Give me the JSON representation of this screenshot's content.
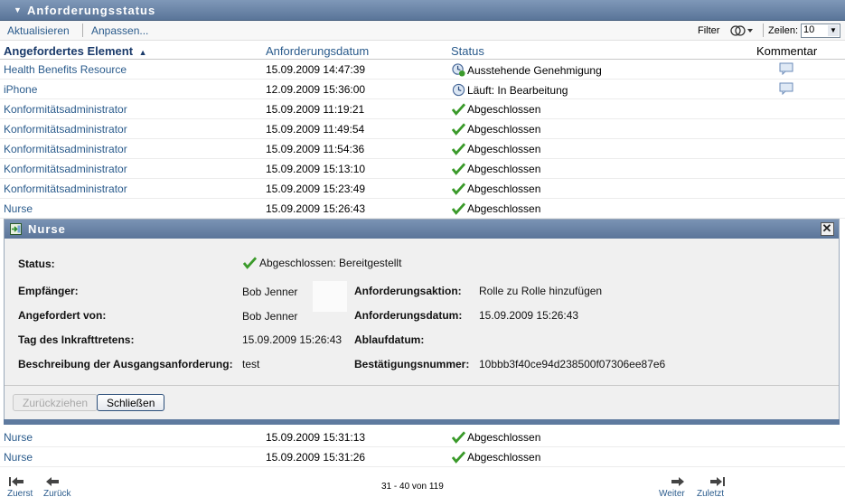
{
  "panel": {
    "title": "Anforderungsstatus"
  },
  "toolbar": {
    "refresh": "Aktualisieren",
    "customize": "Anpassen...",
    "filter_label": "Filter",
    "rows_label": "Zeilen:",
    "rows_value": "10"
  },
  "table": {
    "headers": {
      "element": "Angefordertes Element",
      "date": "Anforderungsdatum",
      "status": "Status",
      "comment": "Kommentar"
    },
    "rows": [
      {
        "element": "Health Benefits Resource",
        "date": "15.09.2009 14:47:39",
        "status": "Ausstehende Genehmigung",
        "status_icon": "pending-approval-icon",
        "has_comment": true
      },
      {
        "element": "iPhone",
        "date": "12.09.2009 15:36:00",
        "status": "Läuft: In Bearbeitung",
        "status_icon": "clock-icon",
        "has_comment": true
      },
      {
        "element": "Konformitätsadministrator",
        "date": "15.09.2009 11:19:21",
        "status": "Abgeschlossen",
        "status_icon": "check-icon",
        "has_comment": false
      },
      {
        "element": "Konformitätsadministrator",
        "date": "15.09.2009 11:49:54",
        "status": "Abgeschlossen",
        "status_icon": "check-icon",
        "has_comment": false
      },
      {
        "element": "Konformitätsadministrator",
        "date": "15.09.2009 11:54:36",
        "status": "Abgeschlossen",
        "status_icon": "check-icon",
        "has_comment": false
      },
      {
        "element": "Konformitätsadministrator",
        "date": "15.09.2009 15:13:10",
        "status": "Abgeschlossen",
        "status_icon": "check-icon",
        "has_comment": false
      },
      {
        "element": "Konformitätsadministrator",
        "date": "15.09.2009 15:23:49",
        "status": "Abgeschlossen",
        "status_icon": "check-icon",
        "has_comment": false
      },
      {
        "element": "Nurse",
        "date": "15.09.2009 15:26:43",
        "status": "Abgeschlossen",
        "status_icon": "check-icon",
        "has_comment": false
      },
      {
        "element": "Nurse",
        "date": "15.09.2009 15:31:13",
        "status": "Abgeschlossen",
        "status_icon": "check-icon",
        "has_comment": false
      },
      {
        "element": "Nurse",
        "date": "15.09.2009 15:31:26",
        "status": "Abgeschlossen",
        "status_icon": "check-icon",
        "has_comment": false
      }
    ]
  },
  "detail": {
    "title": "Nurse",
    "status_label": "Status:",
    "status_value": "Abgeschlossen: Bereitgestellt",
    "recipient_label": "Empfänger:",
    "recipient_value": "Bob Jenner",
    "requested_by_label": "Angefordert von:",
    "requested_by_value": "Bob Jenner",
    "effective_label": "Tag des Inkrafttretens:",
    "effective_value": "15.09.2009 15:26:43",
    "description_label": "Beschreibung der Ausgangsanforderung:",
    "description_value": "test",
    "action_label": "Anforderungsaktion:",
    "action_value": "Rolle zu Rolle hinzufügen",
    "req_date_label": "Anforderungsdatum:",
    "req_date_value": "15.09.2009 15:26:43",
    "expiry_label": "Ablaufdatum:",
    "expiry_value": "",
    "confirmation_label": "Bestätigungsnummer:",
    "confirmation_value": "10bbb3f40ce94d238500f07306ee87e6",
    "withdraw_button": "Zurückziehen",
    "close_button": "Schließen"
  },
  "pager": {
    "first": "Zuerst",
    "back": "Zurück",
    "next": "Weiter",
    "last": "Zuletzt",
    "info": "31 - 40 von 119"
  },
  "colors": {
    "link": "#2a5b8c",
    "header_bar": "#6a84a8",
    "check": "#3a9a2a"
  }
}
